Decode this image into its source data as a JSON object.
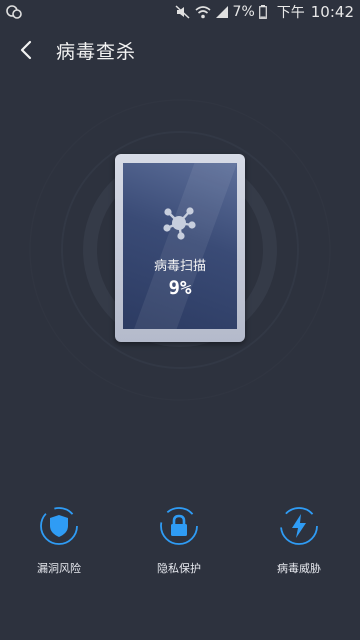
{
  "status_bar": {
    "battery_percent": "7%",
    "ampm": "下午",
    "time": "10:42",
    "icons": [
      "notification-icon",
      "mute-icon",
      "wifi-icon",
      "signal-icon",
      "battery-icon"
    ]
  },
  "header": {
    "back_icon": "back-arrow-icon",
    "title": "病毒查杀"
  },
  "scan": {
    "icon": "virus-icon",
    "label": "病毒扫描",
    "progress_text": "9%",
    "progress": 0.09
  },
  "features": [
    {
      "label": "漏洞风险",
      "icon": "shield-icon"
    },
    {
      "label": "隐私保护",
      "icon": "lock-icon"
    },
    {
      "label": "病毒威胁",
      "icon": "lightning-icon"
    }
  ],
  "colors": {
    "background": "#2d323e",
    "accent": "#2f9cf5",
    "device_frame": "#c6cbd8",
    "device_screen": "#3a4b76"
  }
}
